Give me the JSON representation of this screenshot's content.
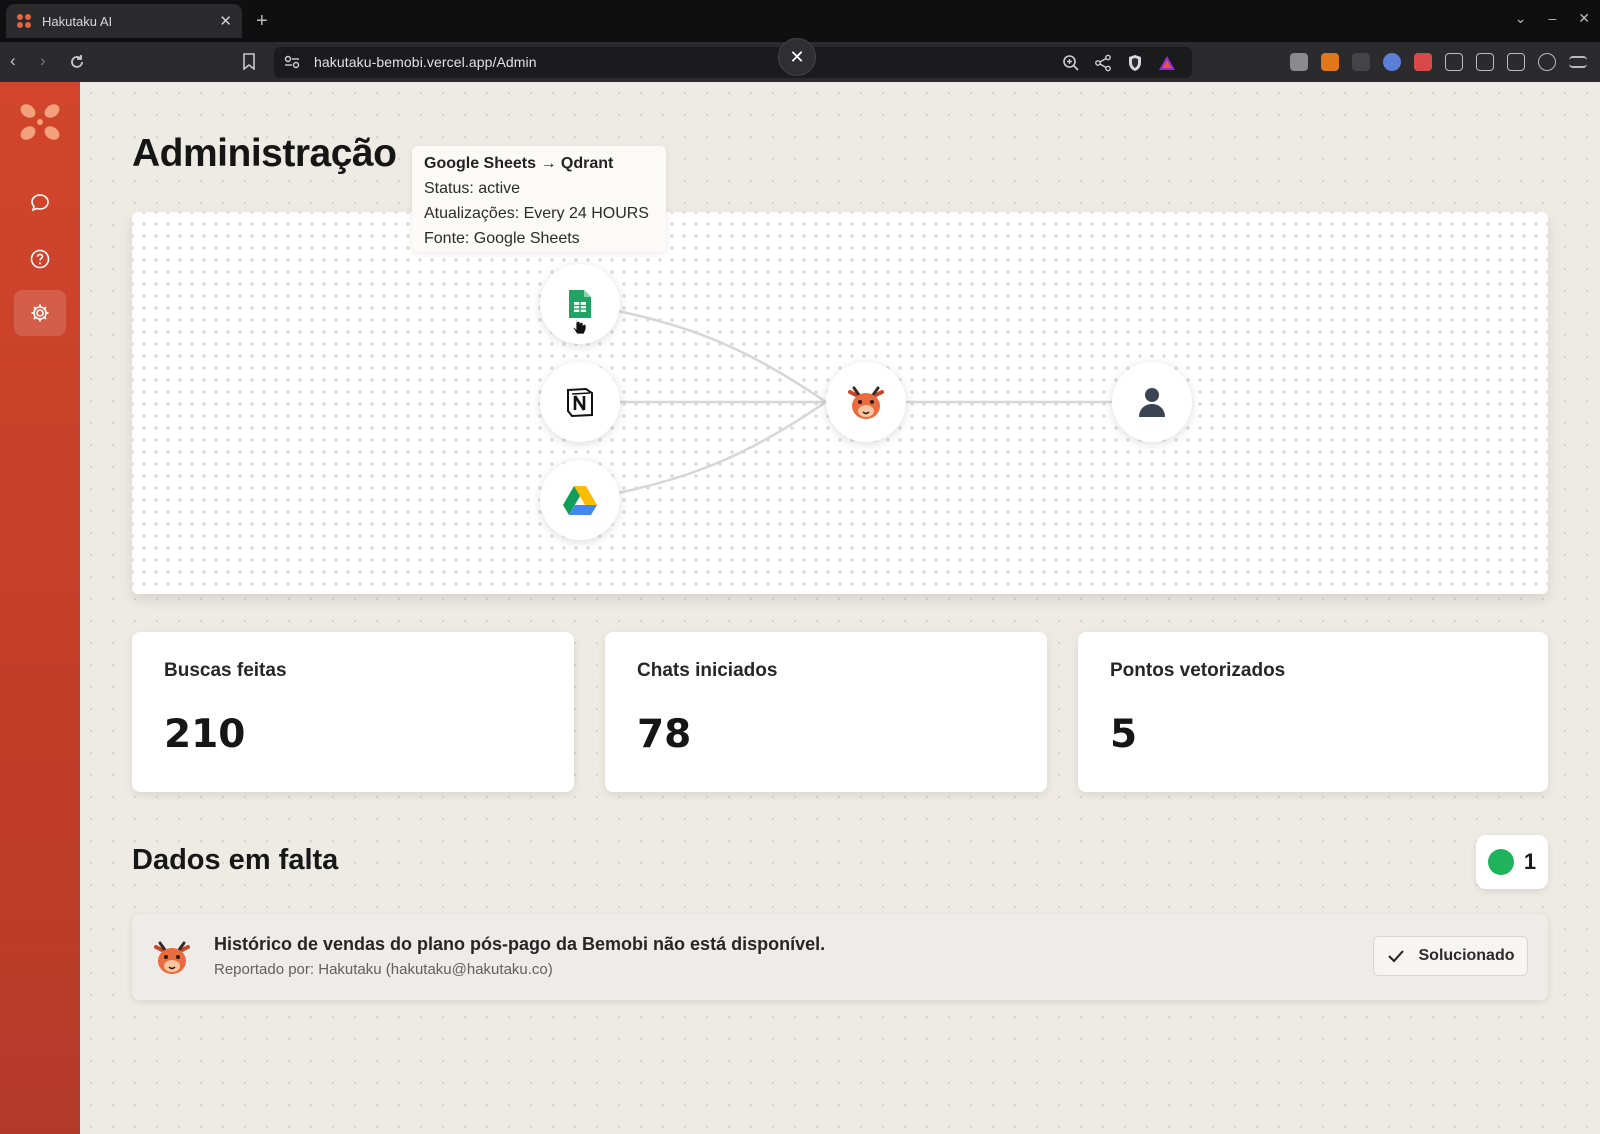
{
  "browser": {
    "tab_title": "Hakutaku AI",
    "url": "hakutaku-bemobi.vercel.app/Admin"
  },
  "sidebar": {
    "items": [
      {
        "icon": "chat-icon",
        "active": false
      },
      {
        "icon": "help-icon",
        "active": false
      },
      {
        "icon": "settings-icon",
        "active": true
      }
    ]
  },
  "page": {
    "title": "Administração"
  },
  "flow": {
    "sources": [
      {
        "name": "Google Sheets",
        "icon": "google-sheets-icon"
      },
      {
        "name": "Notion",
        "icon": "notion-icon"
      },
      {
        "name": "Google Drive",
        "icon": "google-drive-icon"
      }
    ],
    "hub": {
      "icon": "hakutaku-mascot-icon"
    },
    "target": {
      "icon": "user-icon"
    },
    "tooltip": {
      "title": "Google Sheets → Qdrant",
      "status": "Status: active",
      "updates": "Atualizações: Every 24 HOURS",
      "source": "Fonte: Google Sheets"
    }
  },
  "stats": [
    {
      "label": "Buscas feitas",
      "value": "210"
    },
    {
      "label": "Chats iniciados",
      "value": "78"
    },
    {
      "label": "Pontos vetorizados",
      "value": "5"
    }
  ],
  "missing": {
    "title": "Dados em falta",
    "count": "1",
    "count_color": "#1fb45b",
    "items": [
      {
        "text": "Histórico de vendas do plano pós-pago da Bemobi não está disponível.",
        "reporter": "Reportado por: Hakutaku (hakutaku@hakutaku.co)",
        "action": "Solucionado"
      }
    ]
  },
  "colors": {
    "brand": "#c8432b",
    "accent_green": "#1fb45b"
  }
}
